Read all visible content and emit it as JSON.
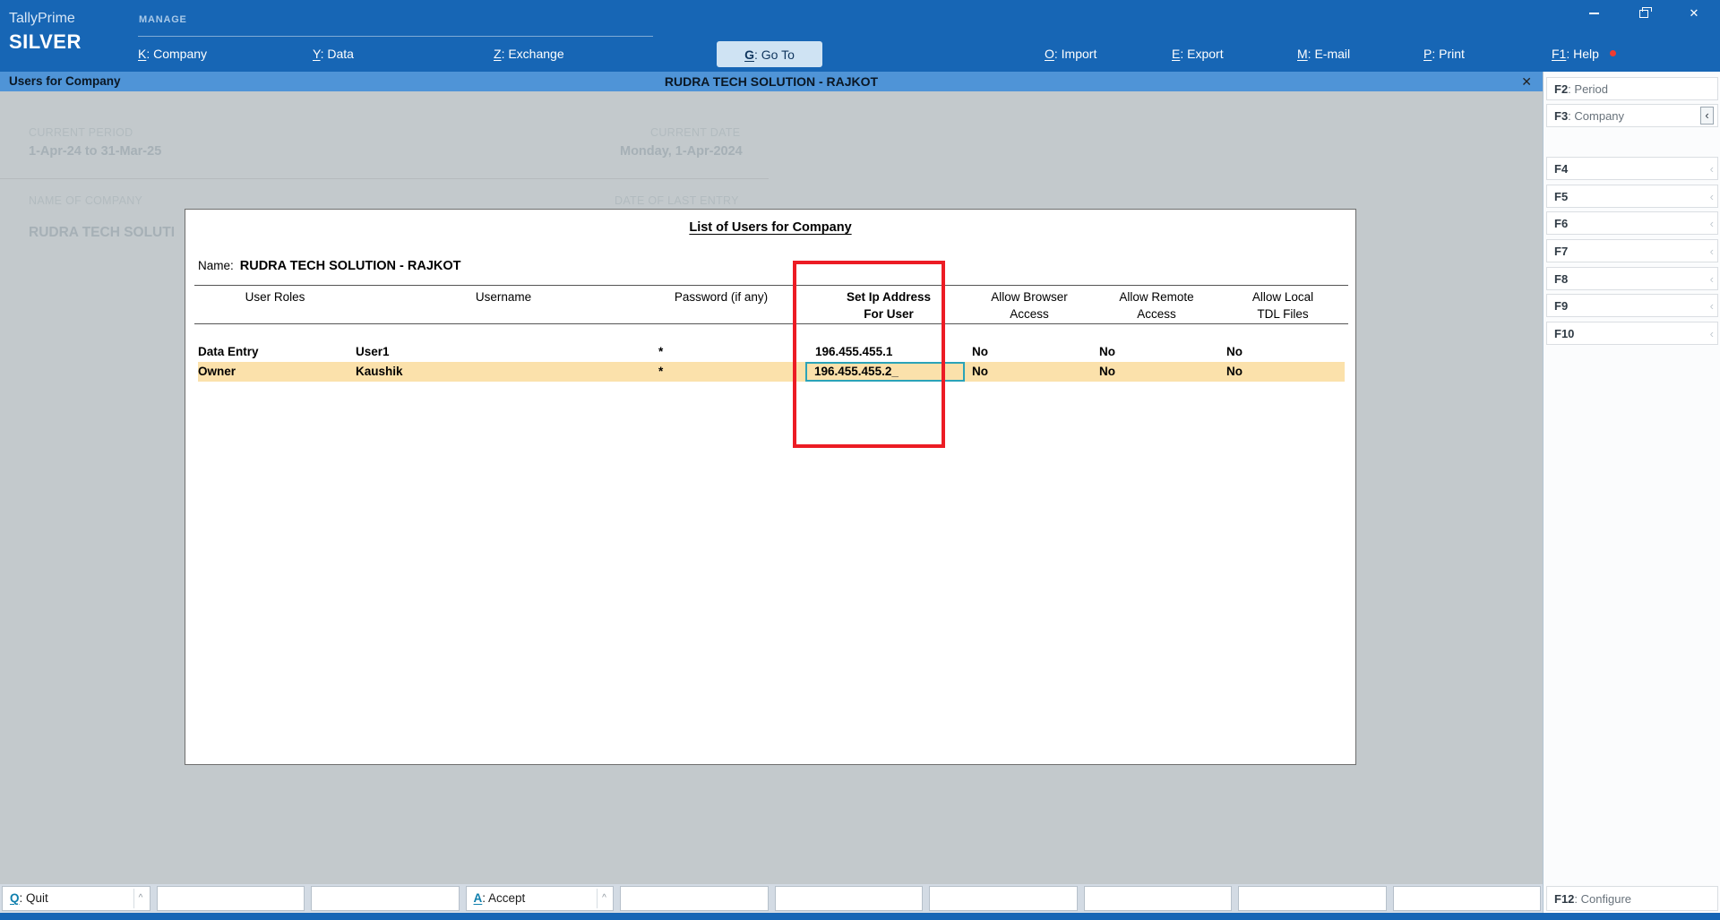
{
  "app": {
    "brand": "TallyPrime",
    "edition": "SILVER"
  },
  "colors": {
    "topbar": "#1766b5",
    "titlebar": "#4f94d7",
    "row_highlight": "#fbe1ab",
    "annotation_red": "#ec1c24",
    "active_field_border": "#2ba3b8"
  },
  "window": {
    "close_glyph": "✕"
  },
  "menubar": {
    "group_label": "MANAGE",
    "items": [
      {
        "key": "K",
        "label": ": Company"
      },
      {
        "key": "Y",
        "label": ": Data"
      },
      {
        "key": "Z",
        "label": ": Exchange"
      },
      {
        "key": "G",
        "label": ": Go To"
      },
      {
        "key": "O",
        "label": ": Import"
      },
      {
        "key": "E",
        "label": ": Export"
      },
      {
        "key": "M",
        "label": ": E-mail"
      },
      {
        "key": "P",
        "label": ": Print"
      },
      {
        "key": "F1",
        "label": ": Help"
      }
    ]
  },
  "titlebar": {
    "left": "Users for Company",
    "center": "RUDRA TECH SOLUTION - RAJKOT",
    "close_glyph": "✕"
  },
  "gateway": {
    "current_period_label": "CURRENT PERIOD",
    "current_period_value": "1-Apr-24 to 31-Mar-25",
    "current_date_label": "CURRENT DATE",
    "current_date_value": "Monday, 1-Apr-2024",
    "company_label": "NAME OF COMPANY",
    "last_entry_label": "DATE OF LAST ENTRY",
    "company_value": "RUDRA TECH SOLUTI"
  },
  "dialog": {
    "title": "List of Users for Company",
    "name_label": "Name:",
    "name_value": "RUDRA TECH SOLUTION - RAJKOT",
    "headers": {
      "roles": "User Roles",
      "username": "Username",
      "password": "Password (if any)",
      "ip": "Set Ip Address\nFor User",
      "browser": "Allow Browser\nAccess",
      "remote": "Allow Remote\nAccess",
      "local": "Allow Local\nTDL Files"
    },
    "rows": [
      {
        "role": "Data Entry",
        "username": "User1",
        "password": "*",
        "ip": "196.455.455.1",
        "browser": "No",
        "remote": "No",
        "local": "No"
      },
      {
        "role": "Owner",
        "username": "Kaushik",
        "password": "*",
        "ip": "196.455.455.2",
        "browser": "No",
        "remote": "No",
        "local": "No"
      }
    ],
    "edit_cursor": "_"
  },
  "sidebar": {
    "chevron_glyph": "‹",
    "items": [
      {
        "key": "F2",
        "label": ": Period"
      },
      {
        "key": "F3",
        "label": ": Company"
      },
      {
        "key": "F4",
        "label": ""
      },
      {
        "key": "F5",
        "label": ""
      },
      {
        "key": "F6",
        "label": ""
      },
      {
        "key": "F7",
        "label": ""
      },
      {
        "key": "F8",
        "label": ""
      },
      {
        "key": "F9",
        "label": ""
      },
      {
        "key": "F10",
        "label": ""
      }
    ],
    "configure": {
      "key": "F12",
      "label": ": Configure"
    }
  },
  "bottombar": {
    "caret_glyph": "^",
    "quit": {
      "key": "Q",
      "label": ": Quit"
    },
    "accept": {
      "key": "A",
      "label": ": Accept"
    }
  }
}
